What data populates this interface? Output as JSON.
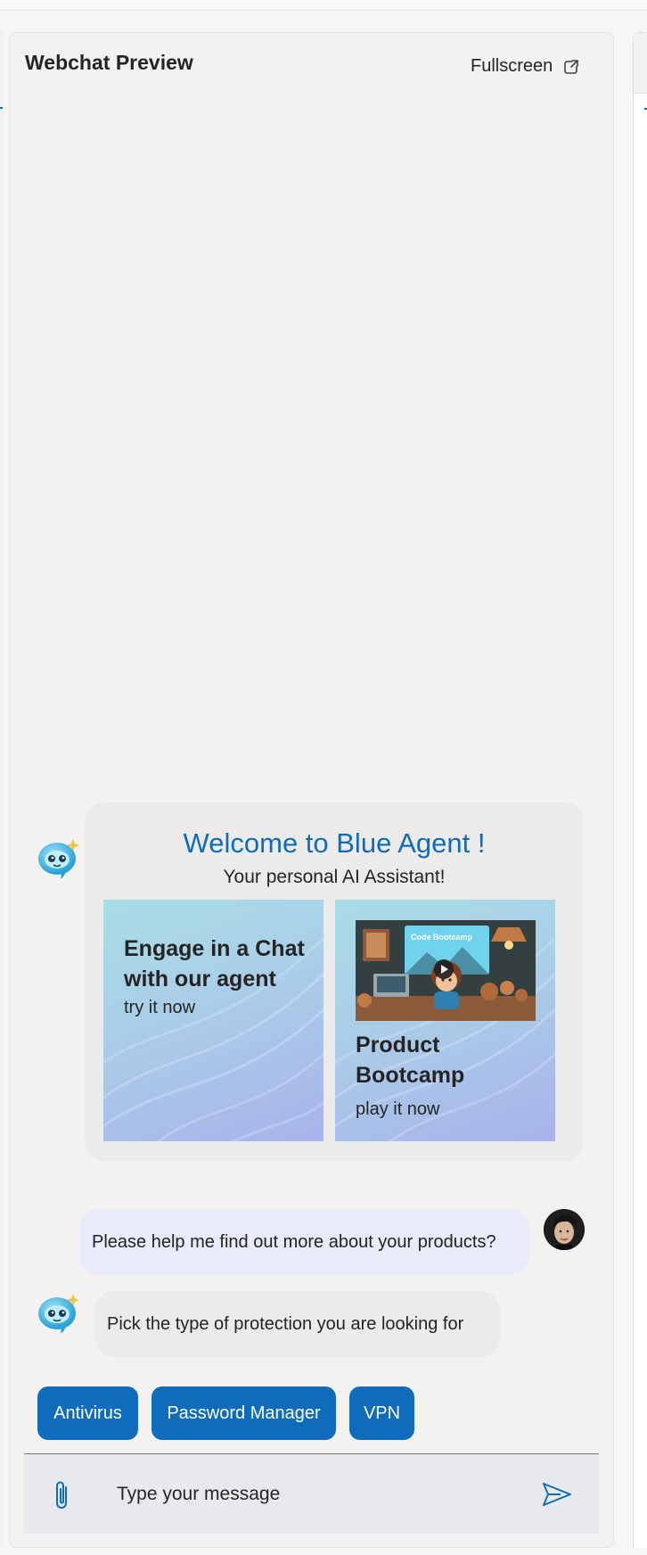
{
  "panel": {
    "title": "Webchat Preview",
    "fullscreen_label": "Fullscreen"
  },
  "welcome": {
    "title": "Welcome to Blue Agent !",
    "subtitle": "Your personal AI Assistant!",
    "cards": [
      {
        "title_line1": "Engage in a Chat",
        "title_line2": "with our agent",
        "action": "try it now"
      },
      {
        "title_line1": "Product",
        "title_line2": "Bootcamp",
        "action": "play it now",
        "thumbnail_caption": "Code Bootcamp"
      }
    ]
  },
  "messages": {
    "user_message": "Please help me find out more about your products?",
    "bot_message": "Pick the type of protection you are looking for"
  },
  "suggestions": [
    "Antivirus",
    "Password Manager",
    "VPN"
  ],
  "composer": {
    "placeholder": "Type your message"
  },
  "colors": {
    "accent": "#0f6cbd",
    "panel_bg": "#f3f2f1",
    "bot_bubble": "#edebe9",
    "user_bubble": "#e8ebfa"
  },
  "icons": {
    "fullscreen": "external-link-icon",
    "bot_avatar": "bot-avatar-icon",
    "attach": "paperclip-icon",
    "send": "send-icon"
  }
}
